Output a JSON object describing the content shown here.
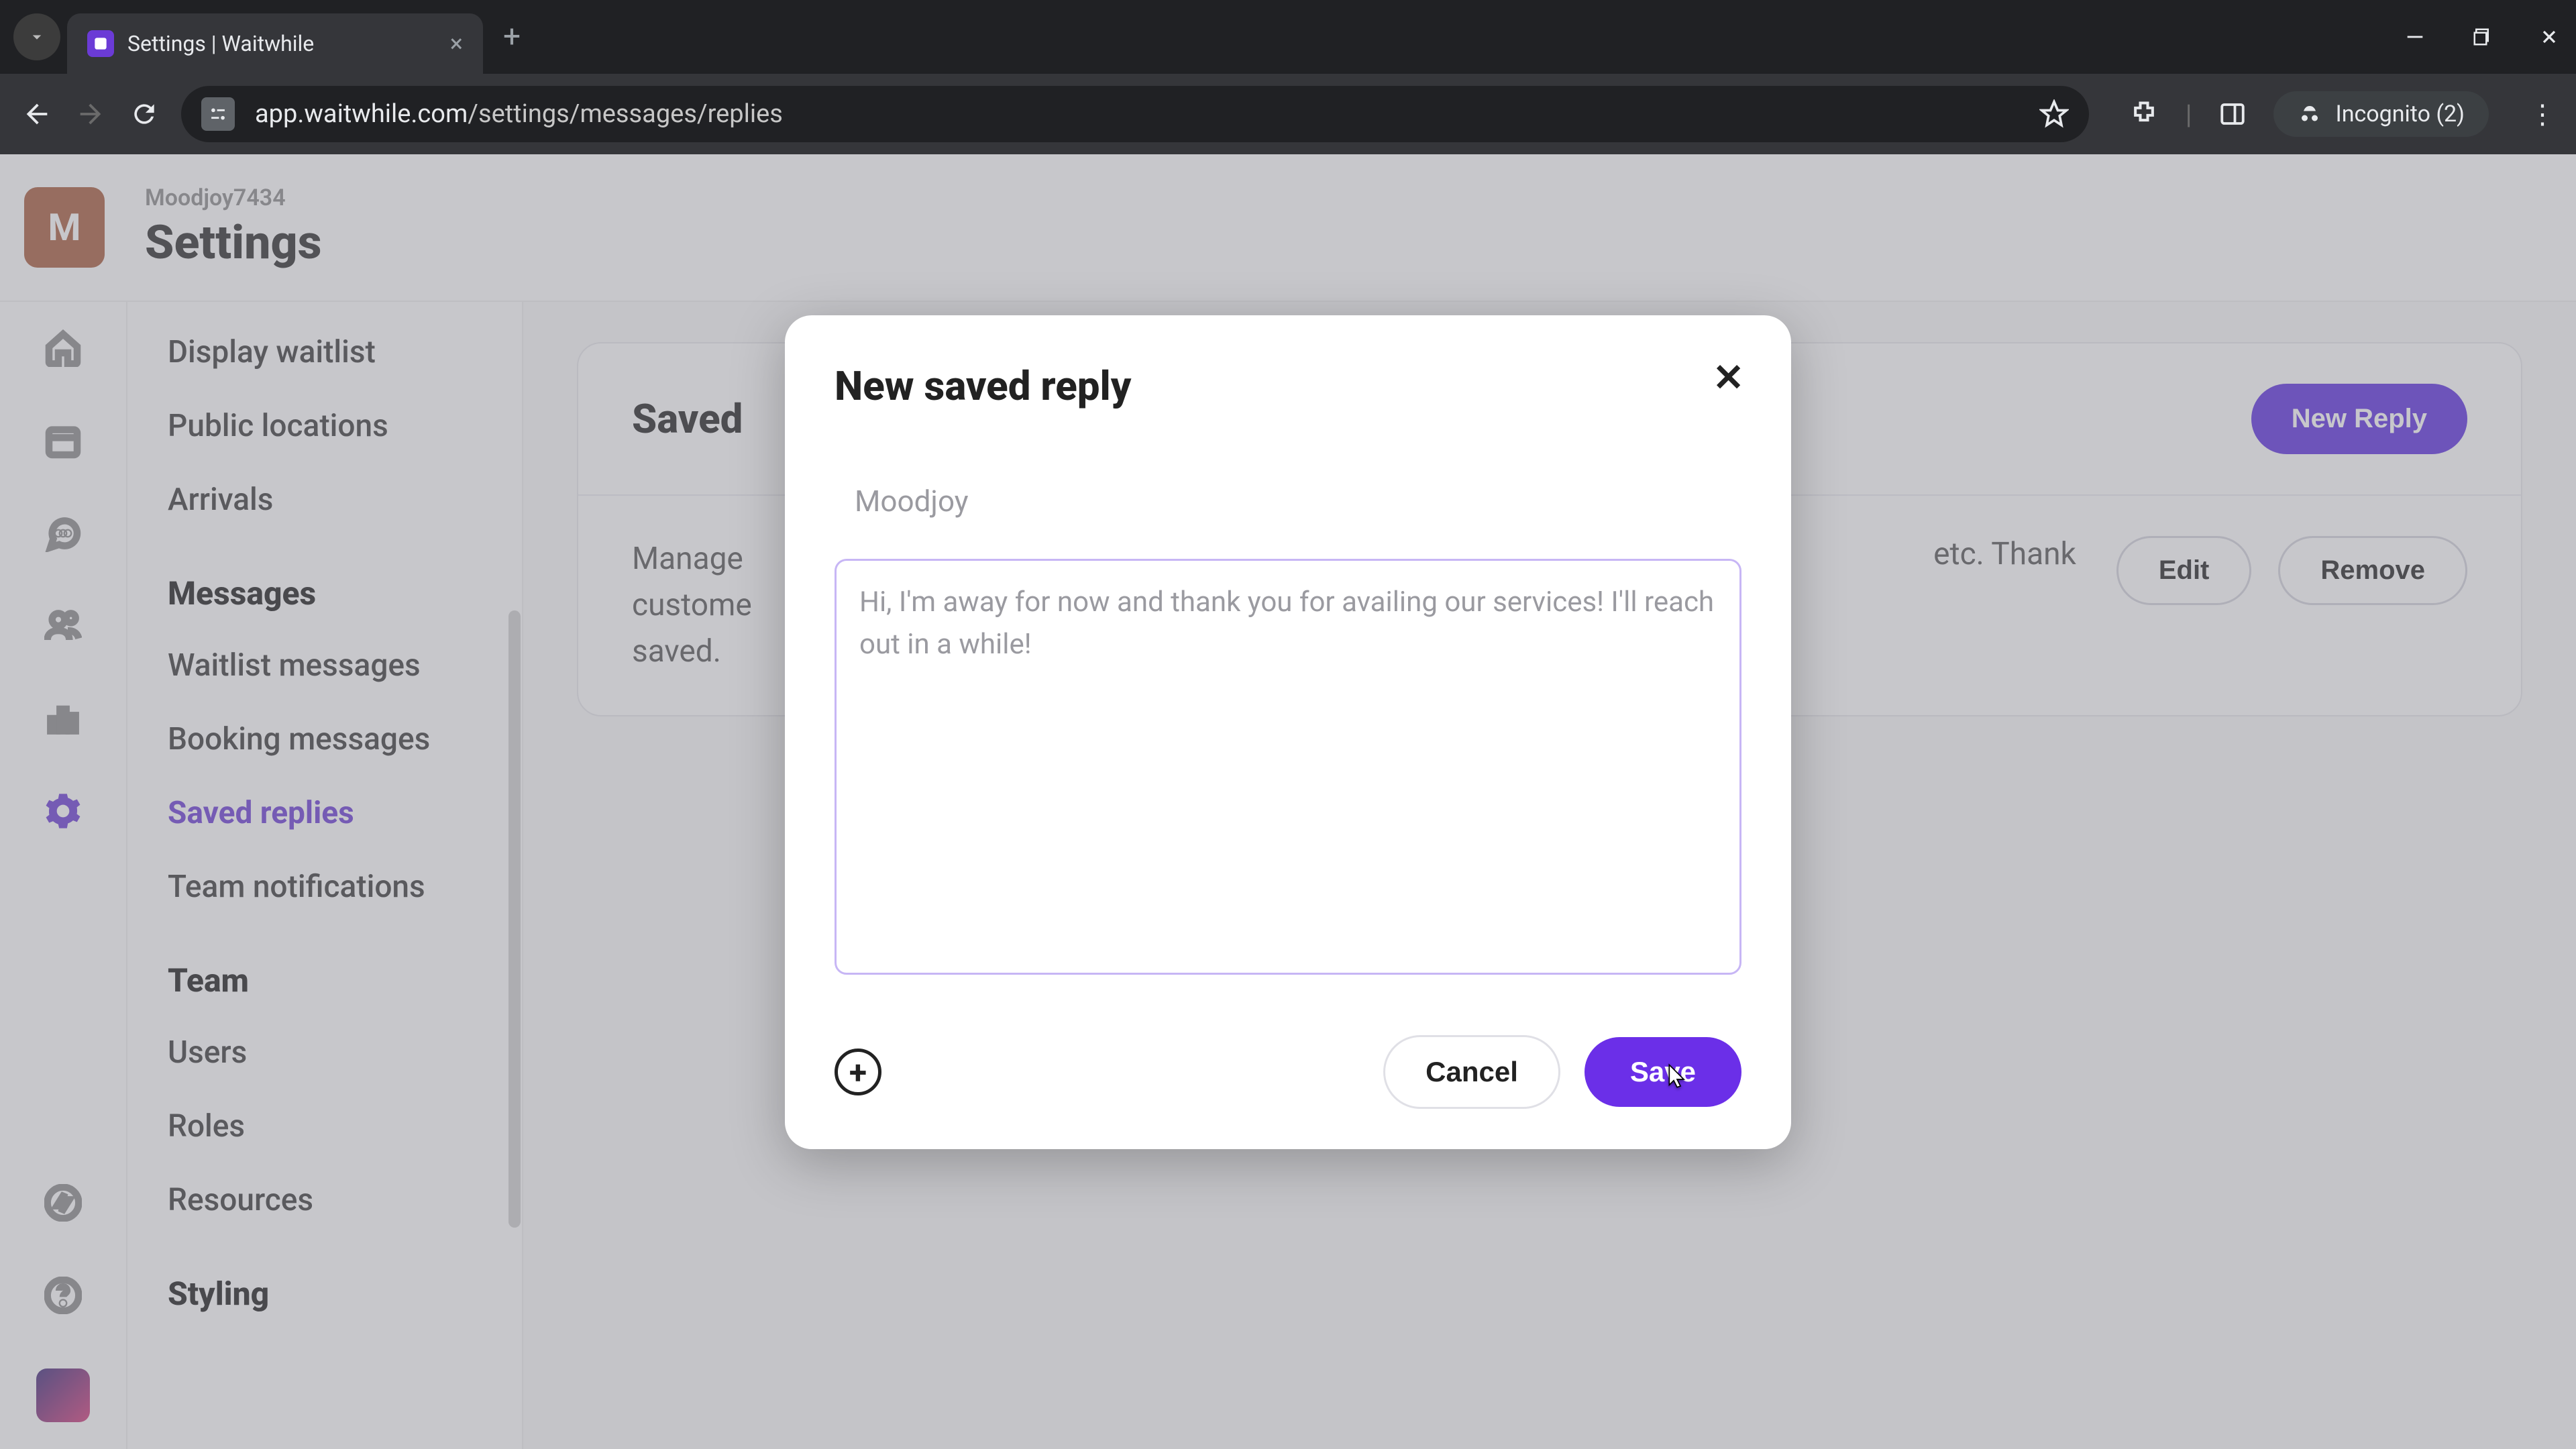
{
  "browser": {
    "tab_title": "Settings | Waitwhile",
    "tab_favicon_letter": "✦",
    "url_host": "app.waitwhile.com",
    "url_path": "/settings/messages/replies",
    "incognito_label": "Incognito (2)"
  },
  "header": {
    "workspace_letter": "M",
    "org_name": "Moodjoy7434",
    "page_title": "Settings"
  },
  "sidebar": {
    "items_top": [
      {
        "label": "Display waitlist"
      },
      {
        "label": "Public locations"
      },
      {
        "label": "Arrivals"
      }
    ],
    "section_messages": "Messages",
    "items_messages": [
      {
        "label": "Waitlist messages"
      },
      {
        "label": "Booking messages"
      },
      {
        "label": "Saved replies",
        "active": true
      },
      {
        "label": "Team notifications"
      }
    ],
    "section_team": "Team",
    "items_team": [
      {
        "label": "Users"
      },
      {
        "label": "Roles"
      },
      {
        "label": "Resources"
      }
    ],
    "section_styling": "Styling"
  },
  "main": {
    "panel_title_prefix": "Saved",
    "new_reply_button": "New Reply",
    "description_line1": "Manage",
    "description_line2": "custome",
    "description_line3": "saved.",
    "description_tail": "etc. Thank",
    "edit_button": "Edit",
    "remove_button": "Remove"
  },
  "modal": {
    "title": "New saved reply",
    "name_value": "Moodjoy",
    "body_value": "Hi, I'm away for now and thank you for availing our services! I'll reach out in a while!",
    "cancel_label": "Cancel",
    "save_label": "Save"
  }
}
